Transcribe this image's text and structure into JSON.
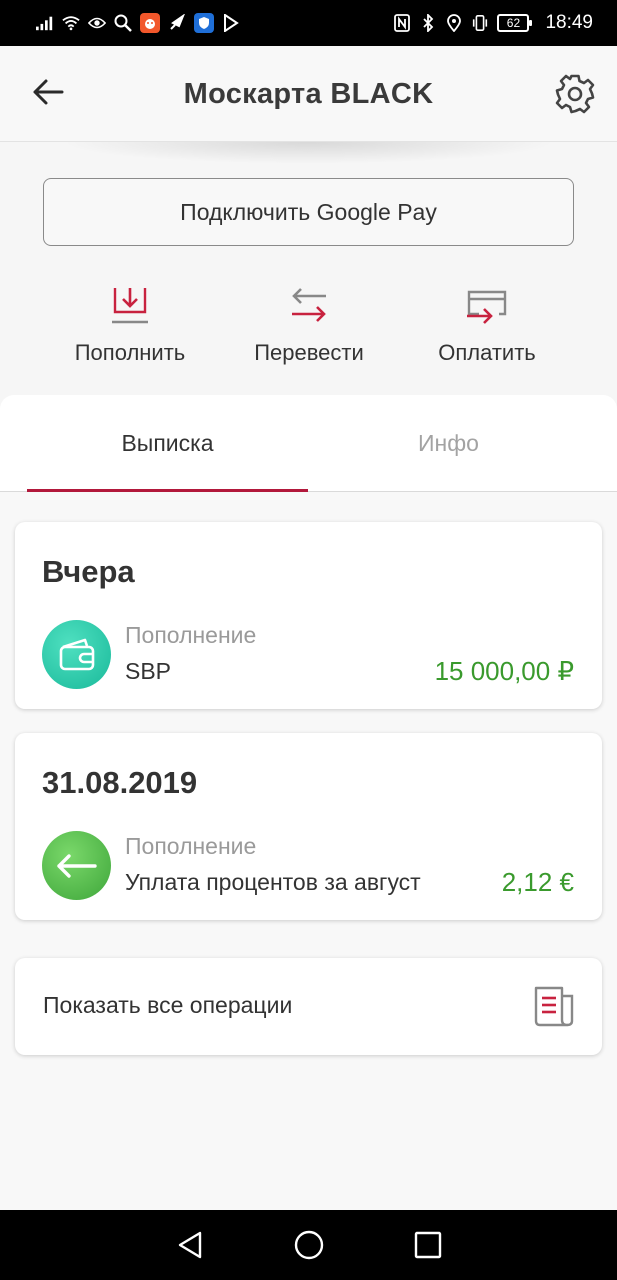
{
  "status_bar": {
    "time": "18:49",
    "battery": "62"
  },
  "app_bar": {
    "title": "Москарта BLACK"
  },
  "google_pay_button": "Подключить Google Pay",
  "actions": [
    {
      "label": "Пополнить",
      "icon": "top-up-icon"
    },
    {
      "label": "Перевести",
      "icon": "transfer-icon"
    },
    {
      "label": "Оплатить",
      "icon": "pay-icon"
    }
  ],
  "tabs": [
    {
      "label": "Выписка",
      "active": true
    },
    {
      "label": "Инфо",
      "active": false
    }
  ],
  "transactions": [
    {
      "date": "Вчера",
      "type": "Пополнение",
      "description": "SBP",
      "amount": "15 000,00 ₽",
      "icon": "wallet-icon"
    },
    {
      "date": "31.08.2019",
      "type": "Пополнение",
      "description": "Уплата процентов за август",
      "amount": "2,12 €",
      "icon": "arrow-left-icon"
    }
  ],
  "show_all": "Показать все операции",
  "colors": {
    "accent": "#b2183b",
    "amount_green": "#3a9a2d",
    "icon_red": "#c8223f"
  }
}
